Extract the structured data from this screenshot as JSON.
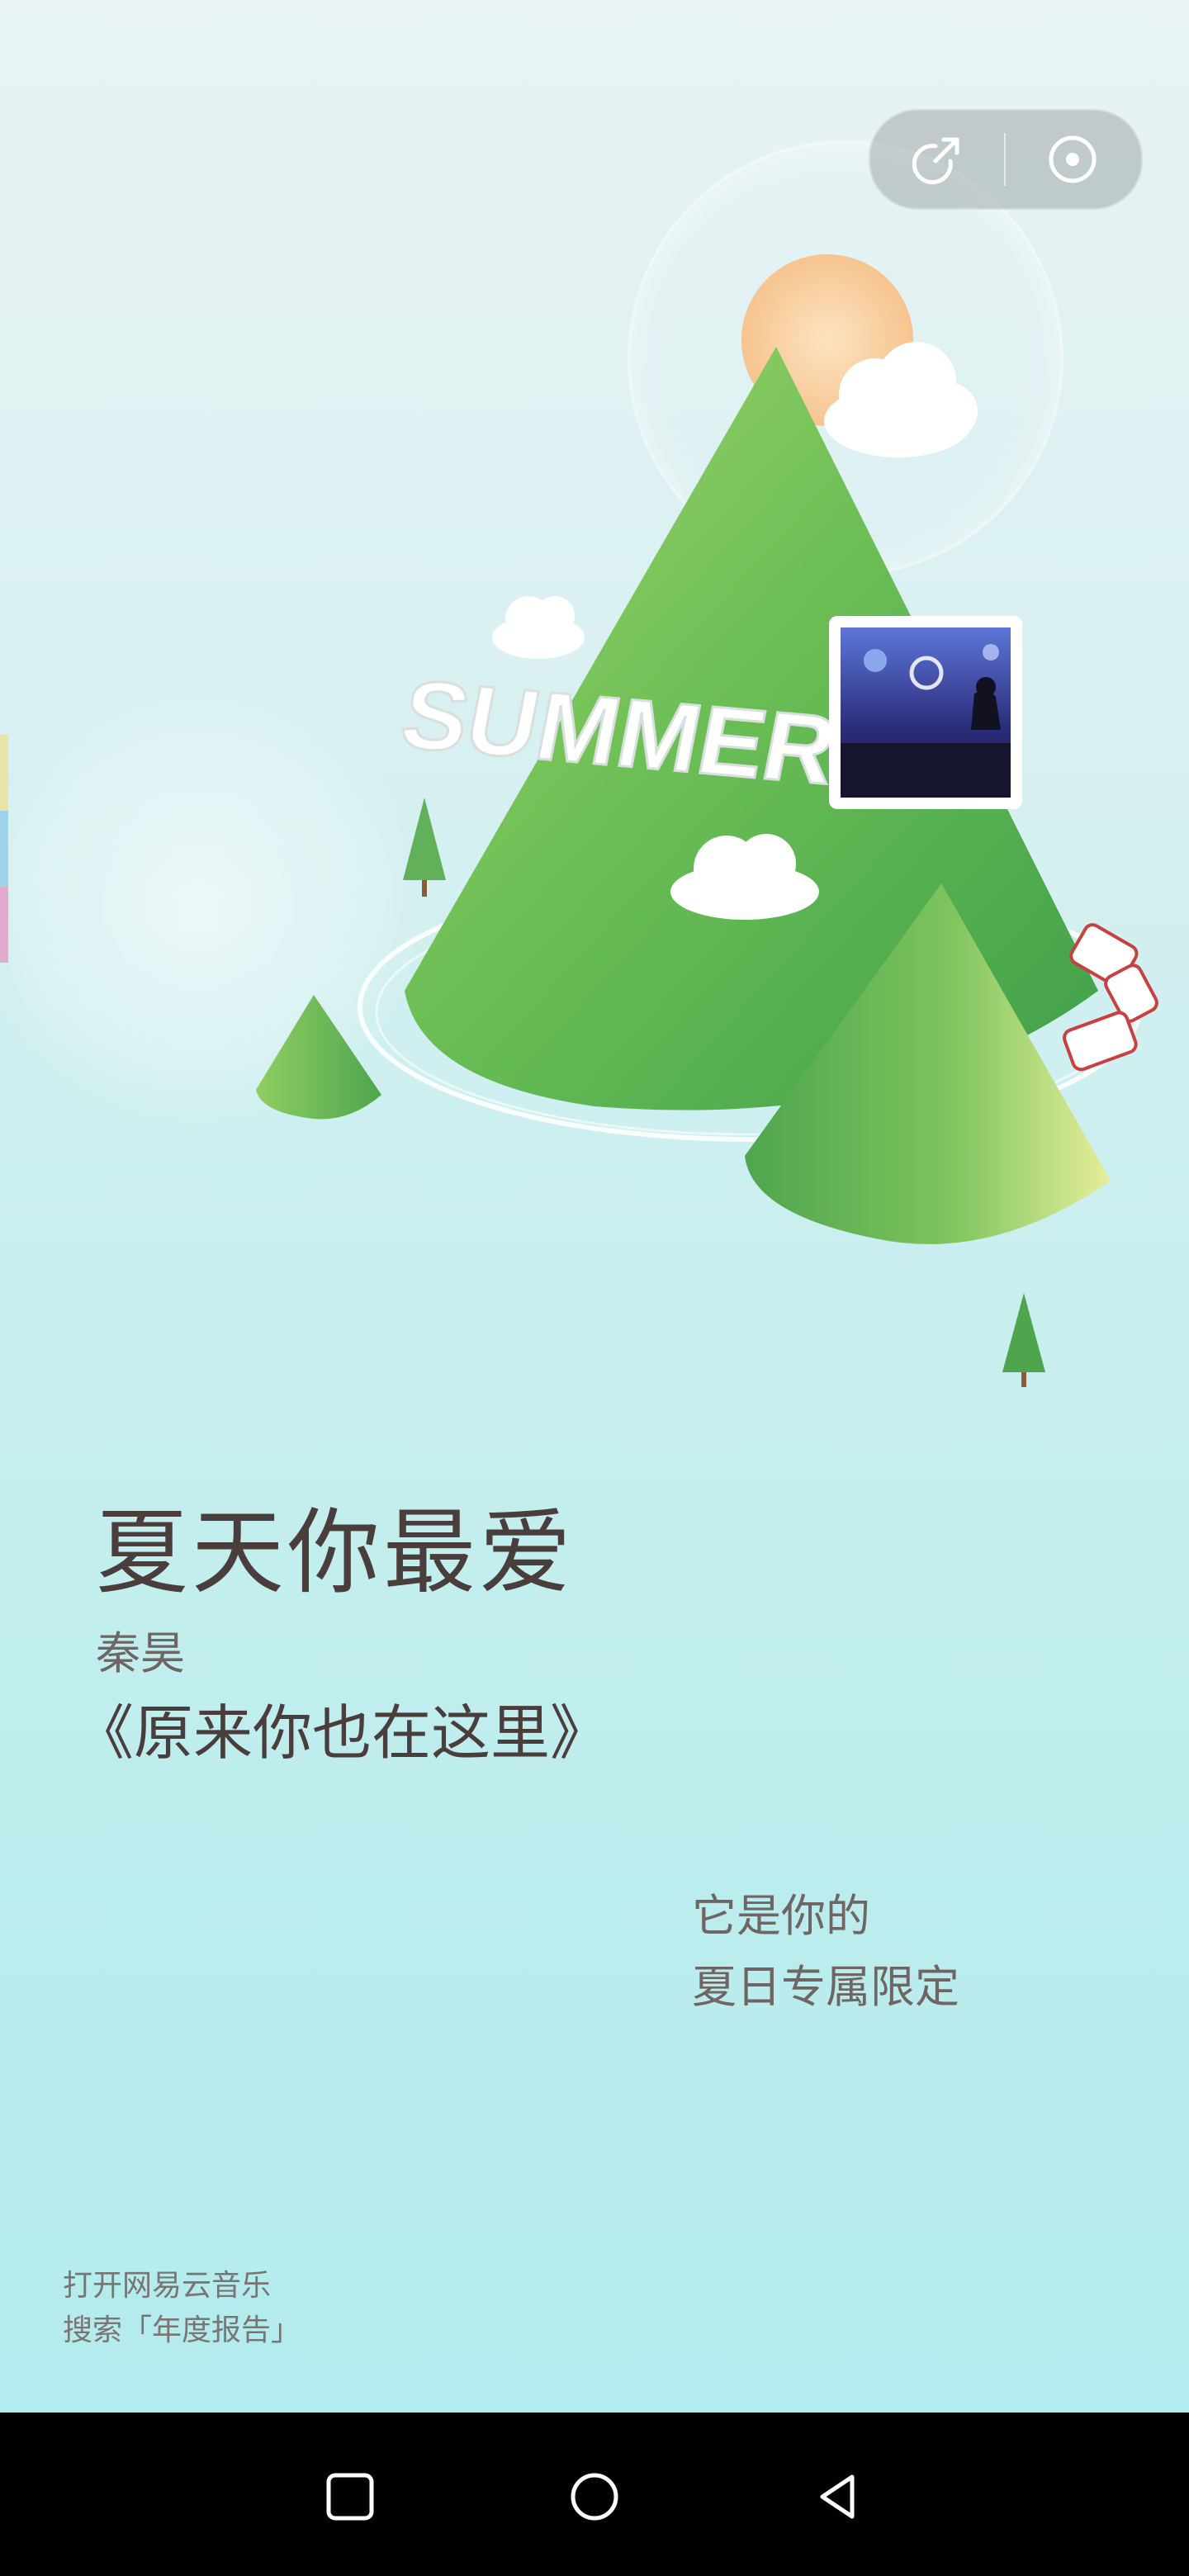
{
  "header": {
    "share_icon": "share-arrow-icon",
    "close_icon": "target-close-icon"
  },
  "illustration": {
    "mountain_text": "SUMMER",
    "album_art": "concert-crowd-image"
  },
  "report": {
    "headline": "夏天你最爱",
    "artist": "秦昊",
    "song": "《原来你也在这里》",
    "tagline_line1": "它是你的",
    "tagline_line2": "夏日专属限定"
  },
  "footer": {
    "line1": "打开网易云音乐",
    "line2": "搜索「年度报告」"
  },
  "edge_tabs": {
    "colors": [
      "#e8e3a6",
      "#9fd3ec",
      "#e4a9cf"
    ]
  },
  "navbar": {
    "recents_icon": "square-recents-icon",
    "home_icon": "circle-home-icon",
    "back_icon": "triangle-back-icon"
  }
}
